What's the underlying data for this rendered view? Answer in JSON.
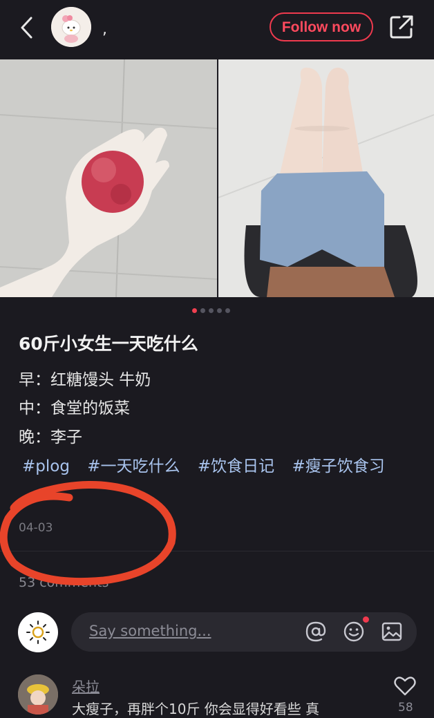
{
  "header": {
    "back_icon": "chevron-left-icon",
    "author_name": ",",
    "follow_label": "Follow now",
    "share_icon": "share-icon"
  },
  "carousel": {
    "image_count": 5,
    "active_index": 0,
    "active_color": "#f04050"
  },
  "post": {
    "title": "60斤小女生一天吃什么",
    "lines": [
      "早：红糖馒头 牛奶",
      "中：食堂的饭菜",
      "晚：李子"
    ],
    "tags": [
      "#plog",
      "#一天吃什么",
      "#饮食日记",
      "#瘦子饮食习"
    ],
    "date": "04-03",
    "comments_count_text": "53 comments"
  },
  "comment_bar": {
    "placeholder": "Say something...",
    "icons": [
      "at-icon",
      "emoji-icon",
      "image-icon"
    ]
  },
  "first_comment": {
    "name": "朵拉",
    "text": "大瘦子，再胖个10斤 你会显得好看些 真",
    "likes": "58"
  },
  "colors": {
    "background": "#1b1a20",
    "accent": "#f03a4e",
    "tag": "#a9c4ee",
    "annotation": "#e8442a"
  }
}
